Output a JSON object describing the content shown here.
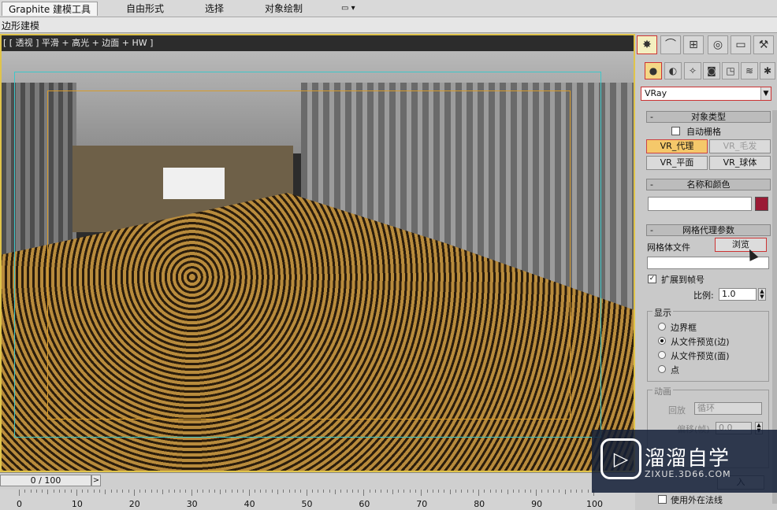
{
  "ribbon": {
    "tabs": [
      {
        "label": "Graphite 建模工具",
        "active": true
      },
      {
        "label": "自由形式",
        "active": false
      },
      {
        "label": "选择",
        "active": false
      },
      {
        "label": "对象绘制",
        "active": false
      }
    ],
    "extra_icon": "display-dropdown-icon"
  },
  "subbar": {
    "label": "边形建模"
  },
  "viewport": {
    "label": "[ [ 透视 ] 平滑 + 高光 + 边面 + HW ]"
  },
  "timeline": {
    "frame_display": "0 / 100",
    "next_button": ">",
    "ruler_labels": [
      "0",
      "10",
      "20",
      "30",
      "40",
      "50",
      "60",
      "70",
      "80",
      "90",
      "100"
    ]
  },
  "command_panel": {
    "tabs": [
      {
        "icon": "create-sun-icon",
        "glyph": "✸",
        "selected": true
      },
      {
        "icon": "modify-curve-icon",
        "glyph": "⌒",
        "selected": false
      },
      {
        "icon": "hierarchy-icon",
        "glyph": "⊞",
        "selected": false
      },
      {
        "icon": "motion-icon",
        "glyph": "◎",
        "selected": false
      },
      {
        "icon": "display-monitor-icon",
        "glyph": "▭",
        "selected": false
      },
      {
        "icon": "utilities-hammer-icon",
        "glyph": "⚒",
        "selected": false
      }
    ],
    "subtypes": [
      {
        "icon": "geometry-sphere-icon",
        "glyph": "●",
        "selected": true
      },
      {
        "icon": "shapes-icon",
        "glyph": "◐",
        "selected": false
      },
      {
        "icon": "lights-icon",
        "glyph": "✧",
        "selected": false
      },
      {
        "icon": "cameras-icon",
        "glyph": "◙",
        "selected": false
      },
      {
        "icon": "helpers-icon",
        "glyph": "◳",
        "selected": false
      },
      {
        "icon": "spacewarps-icon",
        "glyph": "≋",
        "selected": false
      },
      {
        "icon": "systems-gear-icon",
        "glyph": "✱",
        "selected": false
      }
    ],
    "category": "VRay",
    "object_type": {
      "title": "对象类型",
      "autogrid_label": "自动栅格",
      "buttons": [
        {
          "label": "VR_代理",
          "state": "active"
        },
        {
          "label": "VR_毛发",
          "state": "disabled"
        },
        {
          "label": "VR_平面",
          "state": "normal"
        },
        {
          "label": "VR_球体",
          "state": "normal"
        }
      ]
    },
    "name_color": {
      "title": "名称和颜色",
      "name_value": "",
      "swatch_color": "#9b1a35"
    },
    "mesh_proxy": {
      "title": "网格代理参数",
      "file_label": "网格体文件",
      "browse_label": "浏览",
      "file_value": "",
      "expand_label": "扩展到帧号",
      "expand_checked": true,
      "scale_label": "比例:",
      "scale_value": "1.0",
      "display_group": "显示",
      "display_options": [
        {
          "label": "边界框",
          "selected": false
        },
        {
          "label": "从文件预览(边)",
          "selected": true
        },
        {
          "label": "从文件预览(面)",
          "selected": false
        },
        {
          "label": "点",
          "selected": false
        }
      ],
      "animation_group": "动画",
      "playback_label": "回放",
      "playback_value": "循环",
      "offset_label": "偏移(帧)",
      "offset_value": "0.0",
      "partial_button": "入",
      "external_normals_label": "使用外在法线"
    }
  },
  "watermark": {
    "title": "溜溜自学",
    "url": "ZIXUE.3D66.COM",
    "logo_glyph": "▷"
  }
}
